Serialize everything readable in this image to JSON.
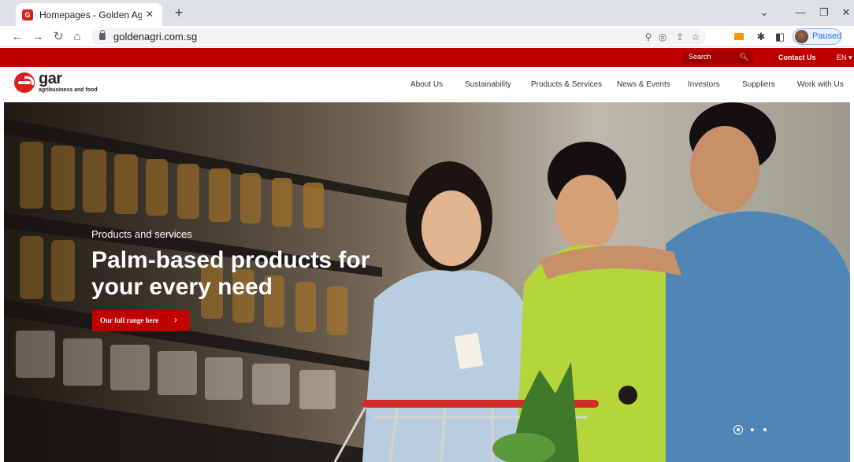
{
  "browser": {
    "tab_title": "Homepages - Golden Agri-Resou",
    "tab_close": "✕",
    "new_tab": "+",
    "url": "goldenagri.com.sg",
    "profile_status": "Paused",
    "icons": [
      "back-arrow",
      "forward-arrow",
      "reload",
      "home",
      "zoom",
      "eye-off",
      "share",
      "star",
      "extension-orange",
      "puzzle",
      "sidepanel",
      "profile"
    ]
  },
  "site": {
    "brand_color": "#c00000",
    "topbar": {
      "search_placeholder": "Search",
      "contact": "Contact Us",
      "language": "EN ▾"
    },
    "logo": {
      "name": "gar",
      "tagline": "agribusiness and food"
    },
    "nav": [
      {
        "label": "About Us"
      },
      {
        "label": "Sustainability"
      },
      {
        "label": "Products & Services"
      },
      {
        "label": "News & Events"
      },
      {
        "label": "Investors"
      },
      {
        "label": "Suppliers"
      },
      {
        "label": "Work with Us"
      }
    ],
    "hero": {
      "kicker": "Products and services",
      "title": "Palm-based products for your every need",
      "button": "Our full range here",
      "button_arrow": "›",
      "slides_total": 3,
      "active_slide": 1
    }
  }
}
